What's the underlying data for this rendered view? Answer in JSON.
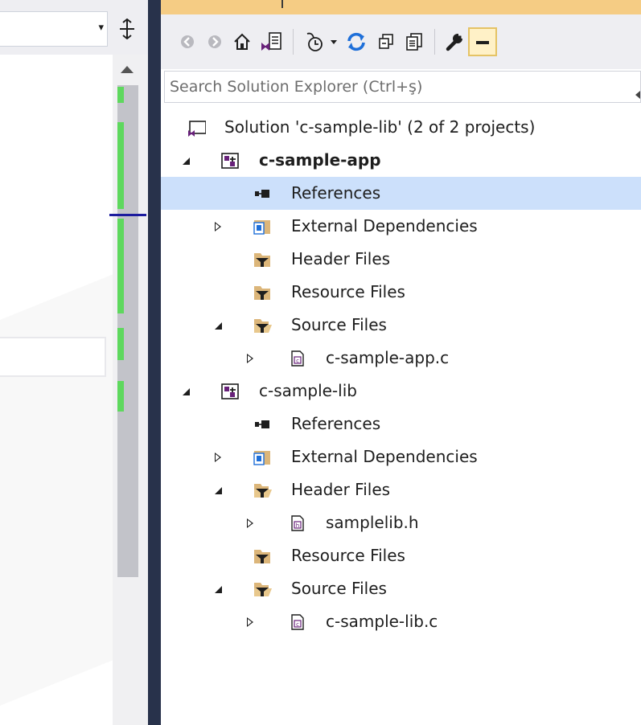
{
  "solution_explorer": {
    "search_placeholder": "Search Solution Explorer (Ctrl+ş)",
    "toolbar_icons": [
      "back-icon",
      "forward-icon",
      "home-icon",
      "switch-views-icon",
      "pending-changes-filter-icon",
      "dropdown-arrow-icon",
      "sync-icon",
      "collapse-all-icon",
      "show-all-files-icon",
      "properties-wrench-icon",
      "preview-toggle-icon"
    ],
    "tree": [
      {
        "label": "Solution 'c-sample-lib' (2 of 2 projects)",
        "icon": "solution-icon",
        "expander": "none"
      },
      {
        "label": "c-sample-app",
        "icon": "project-icon",
        "expander": "expanded",
        "bold": true
      },
      {
        "label": "References",
        "icon": "references-icon",
        "expander": "none",
        "selected": true
      },
      {
        "label": "External Dependencies",
        "icon": "external-dependencies-icon",
        "expander": "collapsed"
      },
      {
        "label": "Header Files",
        "icon": "filter-folder-icon",
        "expander": "none"
      },
      {
        "label": "Resource Files",
        "icon": "filter-folder-icon",
        "expander": "none"
      },
      {
        "label": "Source Files",
        "icon": "filter-folder-open-icon",
        "expander": "expanded"
      },
      {
        "label": "c-sample-app.c",
        "icon": "c-file-icon",
        "expander": "collapsed"
      },
      {
        "label": "c-sample-lib",
        "icon": "project-icon",
        "expander": "expanded"
      },
      {
        "label": "References",
        "icon": "references-icon",
        "expander": "none"
      },
      {
        "label": "External Dependencies",
        "icon": "external-dependencies-icon",
        "expander": "collapsed"
      },
      {
        "label": "Header Files",
        "icon": "filter-folder-open-icon",
        "expander": "expanded"
      },
      {
        "label": "samplelib.h",
        "icon": "h-file-icon",
        "expander": "collapsed"
      },
      {
        "label": "Resource Files",
        "icon": "filter-folder-icon",
        "expander": "none"
      },
      {
        "label": "Source Files",
        "icon": "filter-folder-open-icon",
        "expander": "expanded"
      },
      {
        "label": "c-sample-lib.c",
        "icon": "c-file-icon",
        "expander": "collapsed"
      }
    ]
  },
  "colors": {
    "accent_title_strip": "#f5cc84",
    "selection": "#cce0fb",
    "splitter": "#28324b",
    "scroll_marker_green": "#5ed85e",
    "caret_marker_blue": "#1c1c9e",
    "vs_purple": "#68217a",
    "sync_blue": "#1e6fd9"
  }
}
